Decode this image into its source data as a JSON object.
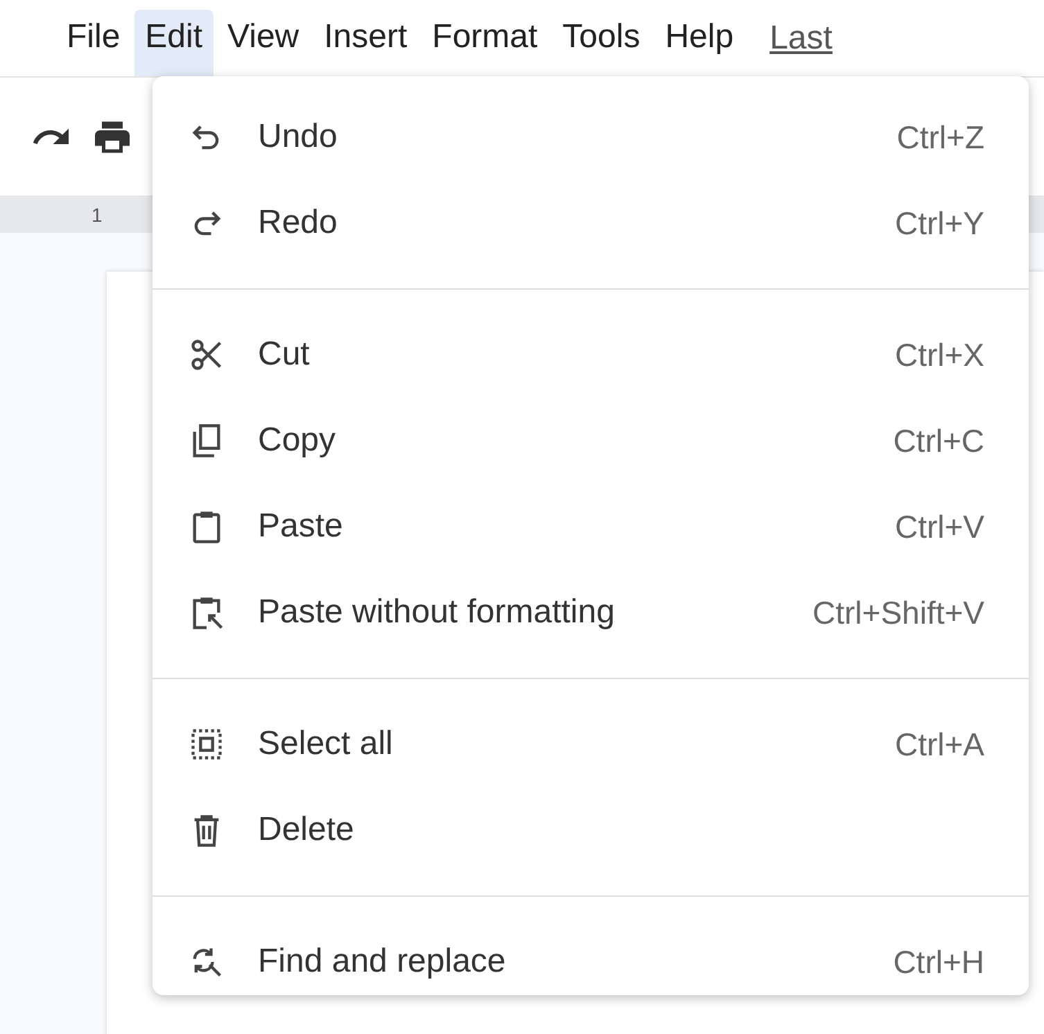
{
  "menubar": {
    "items": [
      {
        "label": "File",
        "selected": false
      },
      {
        "label": "Edit",
        "selected": true
      },
      {
        "label": "View",
        "selected": false
      },
      {
        "label": "Insert",
        "selected": false
      },
      {
        "label": "Format",
        "selected": false
      },
      {
        "label": "Tools",
        "selected": false
      },
      {
        "label": "Help",
        "selected": false
      }
    ],
    "last_edit_link": "Last"
  },
  "ruler": {
    "number": "1"
  },
  "edit_menu": {
    "groups": [
      [
        {
          "kind": "undo",
          "label": "Undo",
          "shortcut": "Ctrl+Z"
        },
        {
          "kind": "redo",
          "label": "Redo",
          "shortcut": "Ctrl+Y"
        }
      ],
      [
        {
          "kind": "cut",
          "label": "Cut",
          "shortcut": "Ctrl+X"
        },
        {
          "kind": "copy",
          "label": "Copy",
          "shortcut": "Ctrl+C"
        },
        {
          "kind": "paste",
          "label": "Paste",
          "shortcut": "Ctrl+V"
        },
        {
          "kind": "pasteplain",
          "label": "Paste without formatting",
          "shortcut": "Ctrl+Shift+V"
        }
      ],
      [
        {
          "kind": "selectall",
          "label": "Select all",
          "shortcut": "Ctrl+A"
        },
        {
          "kind": "delete",
          "label": "Delete"
        }
      ],
      [
        {
          "kind": "find",
          "label": "Find and replace",
          "shortcut": "Ctrl+H"
        }
      ]
    ]
  }
}
